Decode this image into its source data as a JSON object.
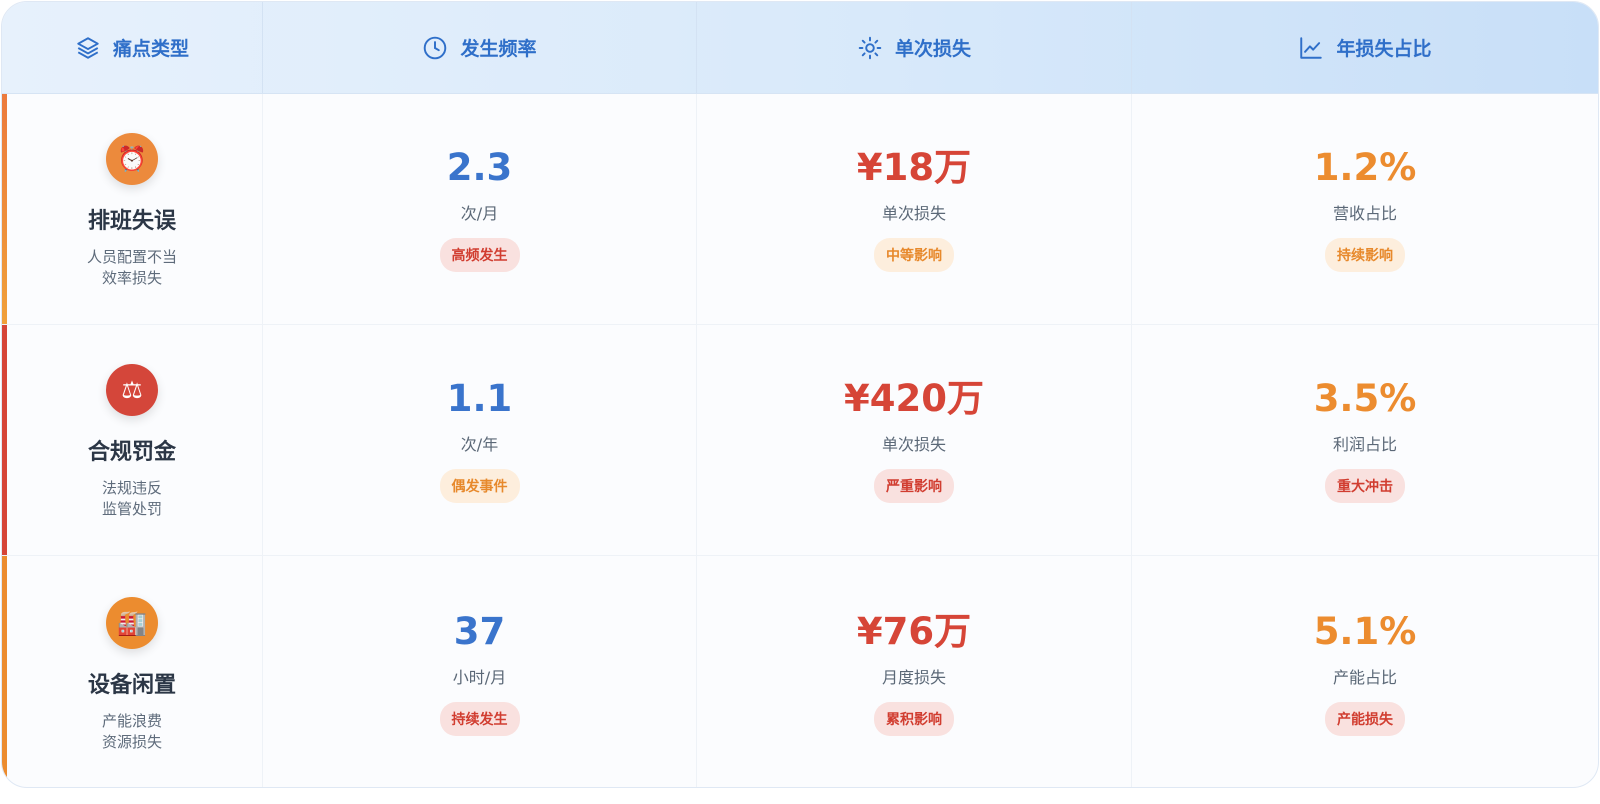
{
  "header": {
    "col1": "痛点类型",
    "col2": "发生频率",
    "col3": "单次损失",
    "col4": "年损失占比"
  },
  "rows": [
    {
      "icon": "alarm-clock-icon",
      "icon_glyph": "⏰",
      "accent": "#ec8c3a",
      "icon_bg": "#ec8a3c",
      "name": "排班失误",
      "desc1": "人员配置不当",
      "desc2": "效率损失",
      "freq_value": "2.3",
      "freq_unit": "次/月",
      "freq_tag": "高频发生",
      "loss_value": "¥18万",
      "loss_unit": "单次损失",
      "loss_tag": "中等影响",
      "ratio_value": "1.2%",
      "ratio_unit": "营收占比",
      "ratio_tag": "持续影响"
    },
    {
      "icon": "scales-icon",
      "icon_glyph": "⚖",
      "accent": "#d64537",
      "icon_bg": "#d4463a",
      "name": "合规罚金",
      "desc1": "法规违反",
      "desc2": "监管处罚",
      "freq_value": "1.1",
      "freq_unit": "次/年",
      "freq_tag": "偶发事件",
      "loss_value": "¥420万",
      "loss_unit": "单次损失",
      "loss_tag": "严重影响",
      "ratio_value": "3.5%",
      "ratio_unit": "利润占比",
      "ratio_tag": "重大冲击"
    },
    {
      "icon": "factory-icon",
      "icon_glyph": "🏭",
      "accent": "#ec8c2f",
      "icon_bg": "#ec8c2f",
      "name": "设备闲置",
      "desc1": "产能浪费",
      "desc2": "资源损失",
      "freq_value": "37",
      "freq_unit": "小时/月",
      "freq_tag": "持续发生",
      "loss_value": "¥76万",
      "loss_unit": "月度损失",
      "loss_tag": "累积影响",
      "ratio_value": "5.1%",
      "ratio_unit": "产能占比",
      "ratio_tag": "产能损失"
    }
  ]
}
